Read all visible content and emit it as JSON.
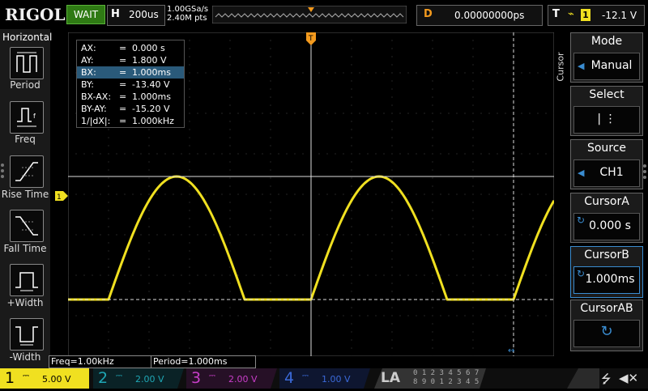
{
  "brand": "RIGOL",
  "run_status": "WAIT",
  "horizontal": {
    "label": "H",
    "timebase": "200us",
    "sample_rate": "1.00GSa/s",
    "memory_depth": "2.40M pts"
  },
  "delay": {
    "label": "D",
    "value": "0.00000000ps"
  },
  "trigger": {
    "label": "T",
    "edge_icon": "rising-edge-icon",
    "source": "1",
    "level": "-12.1 V"
  },
  "left_menu": {
    "title": "Horizontal",
    "items": [
      {
        "label": "Period",
        "icon": "period-icon"
      },
      {
        "label": "Freq",
        "icon": "frequency-icon"
      },
      {
        "label": "Rise Time",
        "icon": "rise-time-icon"
      },
      {
        "label": "Fall Time",
        "icon": "fall-time-icon"
      },
      {
        "label": "+Width",
        "icon": "positive-width-icon"
      },
      {
        "label": "-Width",
        "icon": "negative-width-icon"
      }
    ]
  },
  "cursor_readout": [
    {
      "key": "AX:",
      "eq": "=",
      "value": "0.000 s"
    },
    {
      "key": "AY:",
      "eq": "=",
      "value": "1.800 V"
    },
    {
      "key": "BX:",
      "eq": "=",
      "value": "1.000ms"
    },
    {
      "key": "BY:",
      "eq": "=",
      "value": "-13.40 V"
    },
    {
      "key": "BX-AX:",
      "eq": "=",
      "value": "1.000ms"
    },
    {
      "key": "BY-AY:",
      "eq": "=",
      "value": "-15.20 V"
    },
    {
      "key": "1/|dX|:",
      "eq": "=",
      "value": "1.000kHz"
    }
  ],
  "markers": {
    "ch1_level": "1",
    "trigger_pos": "T",
    "trigger_level_marker": "T"
  },
  "measurements": [
    {
      "text": "Freq=1.00kHz"
    },
    {
      "text": "Period=1.000ms"
    }
  ],
  "right_menu": {
    "tab": "Cursor",
    "mode": {
      "title": "Mode",
      "value": "Manual"
    },
    "select": {
      "title": "Select",
      "value": "|  ⋮"
    },
    "source": {
      "title": "Source",
      "value": "CH1"
    },
    "cursor_a": {
      "title": "CursorA",
      "value": "0.000 s"
    },
    "cursor_b": {
      "title": "CursorB",
      "value": "1.000ms"
    },
    "cursor_ab": {
      "title": "CursorAB",
      "value": ""
    }
  },
  "channels": [
    {
      "num": "1",
      "coupling": "⎓",
      "scale": "5.00 V",
      "color": "#f0e020",
      "active": true
    },
    {
      "num": "2",
      "coupling": "⎓",
      "scale": "2.00 V",
      "color": "#1fa7b5",
      "active": false
    },
    {
      "num": "3",
      "coupling": "⎓",
      "scale": "2.00 V",
      "color": "#c93ec9",
      "active": false
    },
    {
      "num": "4",
      "coupling": "⎓",
      "scale": "1.00 V",
      "color": "#3b6ad9",
      "active": false
    }
  ],
  "la": {
    "label": "LA",
    "row1": "0 1 2 3  4 5 6 7",
    "row2": "8 9 0 1  2 3 4 5"
  },
  "status_icons": [
    "usb-icon",
    "speaker-mute-icon"
  ],
  "colors": {
    "ch1": "#f0e020",
    "accent_orange": "#f39a1e",
    "grid": "#3a3a3a"
  }
}
